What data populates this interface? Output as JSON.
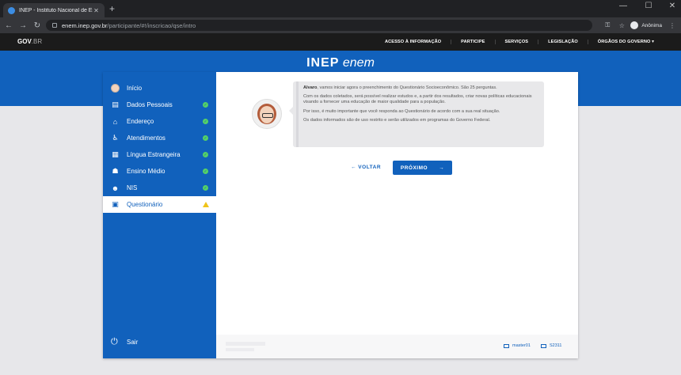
{
  "browser": {
    "tab_title": "INEP - Instituto Nacional de Est…",
    "url_host": "enem.inep.gov.br",
    "url_path": "/participante/#!/inscricao/qse/intro",
    "profile_label": "Anônima",
    "window_controls": [
      "—",
      "☐",
      "✕"
    ]
  },
  "govbar": {
    "logo_main": "GOV",
    "logo_suffix": ".BR",
    "links": [
      "ACESSO À INFORMAÇÃO",
      "PARTICIPE",
      "SERVIÇOS",
      "LEGISLAÇÃO",
      "ÓRGÃOS DO GOVERNO ▾"
    ]
  },
  "brand": {
    "inep": "INEP",
    "enem": "enem"
  },
  "sidebar": {
    "items": [
      {
        "label": "Início",
        "icon": "avatar-icon",
        "status": "none"
      },
      {
        "label": "Dados Pessoais",
        "icon": "id-card-icon",
        "status": "ok"
      },
      {
        "label": "Endereço",
        "icon": "home-icon",
        "status": "ok"
      },
      {
        "label": "Atendimentos",
        "icon": "accessibility-icon",
        "status": "ok"
      },
      {
        "label": "Língua Estrangeira",
        "icon": "language-icon",
        "status": "ok"
      },
      {
        "label": "Ensino Médio",
        "icon": "graduation-icon",
        "status": "ok"
      },
      {
        "label": "NIS",
        "icon": "people-icon",
        "status": "ok"
      },
      {
        "label": "Questionário",
        "icon": "clipboard-icon",
        "status": "warning"
      }
    ],
    "logout_label": "Sair"
  },
  "intro": {
    "name": "Alvaro",
    "p1": ", vamos iniciar agora o preenchimento do Questionário Socioeconômico. São 25 perguntas.",
    "p2": "Com os dados coletados, será possível realizar estudos e, a partir dos resultados, criar novas políticas educacionais visando a fornecer uma educação de maior qualidade para a população.",
    "p3": "Por isso, é muito importante que você responda ao Questionário de acordo com a sua real situação.",
    "p4": "Os dados informados são de uso restrito e serão utilizados em programas do Governo Federal."
  },
  "actions": {
    "back": "← VOLTAR",
    "next": "PRÓXIMO",
    "next_arrow": "→"
  },
  "footer": {
    "meta1": "master01",
    "meta2": "S2311"
  },
  "colors": {
    "primary": "#1161bc",
    "ok": "#55d265",
    "warn": "#f0c419"
  }
}
